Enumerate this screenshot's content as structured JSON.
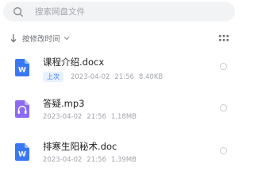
{
  "search": {
    "placeholder": "搜索网盘文件",
    "icon": "search-icon"
  },
  "sort": {
    "label": "按修改时间",
    "direction_icon": "sort-down-arrow-icon",
    "caret_icon": "chevron-down-icon",
    "view_icon": "grid-view-icon"
  },
  "files": [
    {
      "name": "课程介绍.docx",
      "type_icon": "word-doc-icon",
      "badge": "上次",
      "date": "2023-04-02",
      "time": "21:56",
      "size": "8.40KB"
    },
    {
      "name": "答疑.mp3",
      "type_icon": "audio-file-icon",
      "badge": "",
      "date": "2023-04-02",
      "time": "21:56",
      "size": "1.18MB"
    },
    {
      "name": "排寒生阳秘术.doc",
      "type_icon": "word-doc-icon",
      "badge": "",
      "date": "2023-04-02",
      "time": "21:56",
      "size": "1.39MB"
    }
  ],
  "colors": {
    "word_blue": "#3a78f2",
    "audio_purple": "#8c6bf2",
    "badge_bg": "#e8f1ff"
  }
}
